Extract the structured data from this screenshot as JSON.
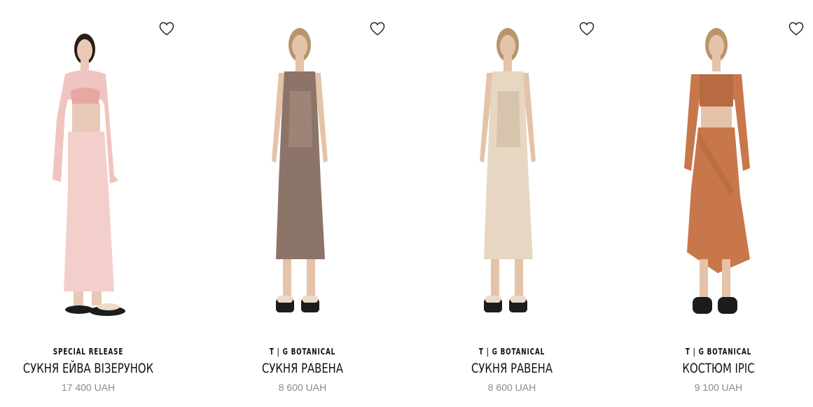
{
  "products": [
    {
      "brand": "SPECIAL RELEASE",
      "title": "СУКНЯ ЕЙВА ВІЗЕРУНОК",
      "price": "17 400 UAH",
      "icon": "heart-outline-icon",
      "colors": {
        "garment": "#f0c4c0",
        "skin": "#e8c8b6",
        "hair": "#2a1d18",
        "shoe": "#1c1c1c"
      }
    },
    {
      "brand": "T | G BOTANICAL",
      "title": "СУКНЯ РАВЕНА",
      "price": "8 600 UAH",
      "icon": "heart-outline-icon",
      "colors": {
        "garment": "#8c7468",
        "skin": "#e5c3a8",
        "hair": "#b8956a",
        "shoe": "#1c1c1c"
      }
    },
    {
      "brand": "T | G BOTANICAL",
      "title": "СУКНЯ РАВЕНА",
      "price": "8 600 UAH",
      "icon": "heart-outline-icon",
      "colors": {
        "garment": "#e6d6c2",
        "skin": "#e5c3a8",
        "hair": "#b8956a",
        "shoe": "#1c1c1c"
      }
    },
    {
      "brand": "T | G BOTANICAL",
      "title": "КОСТЮМ ІРІС",
      "price": "9 100 UAH",
      "icon": "heart-outline-icon",
      "colors": {
        "garment": "#c8774a",
        "skin": "#e5c3a8",
        "hair": "#b8956a",
        "shoe": "#1c1c1c"
      }
    }
  ]
}
